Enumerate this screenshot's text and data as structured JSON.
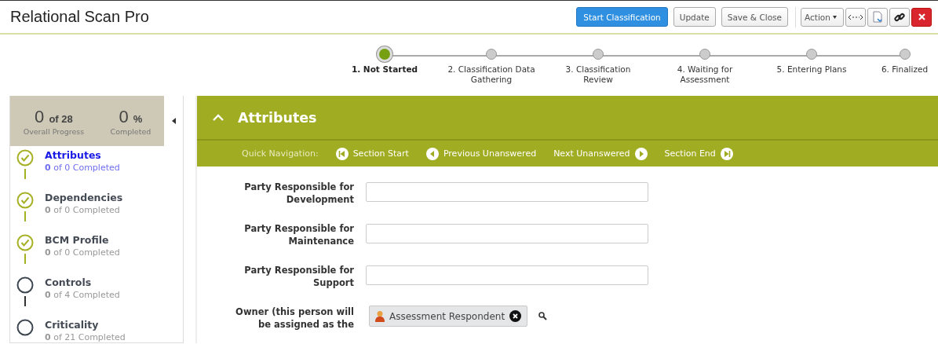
{
  "window": {
    "title": "Relational Scan Pro"
  },
  "toolbar": {
    "buttons": [
      {
        "label": "Start Classification",
        "kind": "primary"
      },
      {
        "label": "Update",
        "kind": "default"
      },
      {
        "label": "Save & Close",
        "kind": "default"
      }
    ],
    "action_menu": {
      "label": "Action"
    }
  },
  "stepper": {
    "steps": [
      {
        "label": "1. Not Started",
        "selected": true
      },
      {
        "label": "2. Classification Data Gathering",
        "selected": false
      },
      {
        "label": "3. Classification Review",
        "selected": false
      },
      {
        "label": "4. Waiting for Assessment",
        "selected": false
      },
      {
        "label": "5. Entering Plans",
        "selected": false
      },
      {
        "label": "6. Finalized",
        "selected": false
      }
    ]
  },
  "sidebar": {
    "summary": {
      "count": "0",
      "count_suffix": "of 28",
      "count_caption": "Overall Progress",
      "percent": "0",
      "percent_suffix": "%",
      "percent_caption": "Completed"
    },
    "sections": [
      {
        "title": "Attributes",
        "progress": "**0** of 0 Completed",
        "completed": true,
        "selected": true
      },
      {
        "title": "Dependencies",
        "progress": "**0** of 0 Completed",
        "completed": true,
        "selected": false
      },
      {
        "title": "BCM Profile",
        "progress": "**0** of 0 Completed",
        "completed": true,
        "selected": false
      },
      {
        "title": "Controls",
        "progress": "**0** of 4 Completed",
        "completed": false,
        "selected": false
      },
      {
        "title": "Criticality",
        "progress": "**0** of 21 Completed",
        "completed": false,
        "selected": false
      }
    ]
  },
  "section": {
    "title": "Attributes",
    "expanded": true,
    "quick_navigation": {
      "label": "Quick Navigation:",
      "links": [
        {
          "label": "Section Start",
          "kind": "first"
        },
        {
          "label": "Previous Unanswered",
          "kind": "prev"
        },
        {
          "label": "Next Unanswered",
          "kind": "next"
        },
        {
          "label": "Section End",
          "kind": "last"
        }
      ]
    },
    "fields": [
      {
        "label": "Party Responsible for Development",
        "kind": "text"
      },
      {
        "label": "Party Responsible for Maintenance",
        "kind": "text"
      },
      {
        "label": "Party Responsible for Support",
        "kind": "text"
      },
      {
        "label": "Owner (this person will be assigned as the",
        "kind": "person",
        "chips": [
          {
            "label": "Assessment Respondent"
          }
        ]
      }
    ]
  }
}
